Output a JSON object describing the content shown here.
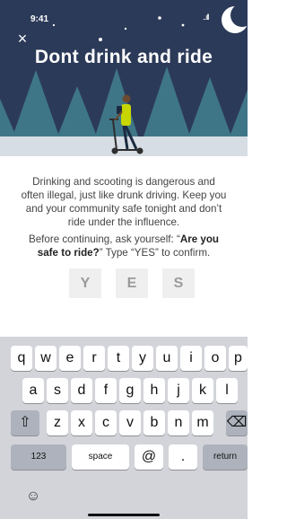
{
  "status_bar": {
    "time": "9:41",
    "signal": "..ıll"
  },
  "hero": {
    "close_icon": "×",
    "title": "Dont drink and ride"
  },
  "warning": {
    "body": "Drinking and scooting is dangerous and often illegal, just like drunk driving. Keep you and your community safe tonight and don’t ride under the influence."
  },
  "prompt": {
    "before": "Before continuing, ask yourself: “",
    "bold": "Are you safe to ride?",
    "after": "” Type “YES” to confirm."
  },
  "code_inputs": [
    "Y",
    "E",
    "S"
  ],
  "keyboard": {
    "row1": [
      "q",
      "w",
      "e",
      "r",
      "t",
      "y",
      "u",
      "i",
      "o",
      "p"
    ],
    "row2": [
      "a",
      "s",
      "d",
      "f",
      "g",
      "h",
      "j",
      "k",
      "l"
    ],
    "row3": [
      "z",
      "x",
      "c",
      "v",
      "b",
      "n",
      "m"
    ],
    "shift_icon": "⇧",
    "backspace_icon": "⌫",
    "numbers_label": "123",
    "space_label": "space",
    "at_label": "@",
    "period_label": ".",
    "return_label": "return",
    "emoji_icon": "☺"
  },
  "colors": {
    "sky": "#2c3a59",
    "trees": "#3f7687",
    "snow": "#d7dde4",
    "rider_shirt": "#c7d600",
    "keyboard": "#d2d4d9"
  }
}
